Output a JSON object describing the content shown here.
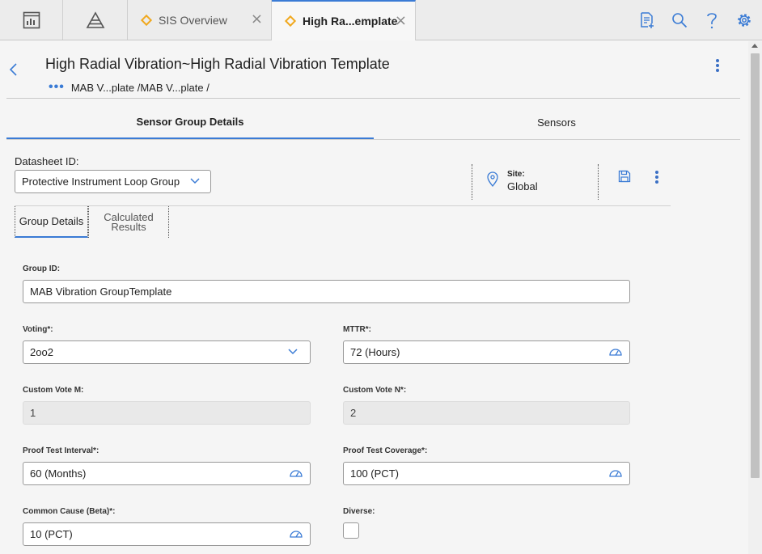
{
  "tabs": {
    "home_icon": "dashboard-icon",
    "hierarchy_icon": "pyramid-icon",
    "items": [
      {
        "label": "SIS Overview",
        "icon": "diamond-icon"
      },
      {
        "label": "High Ra...emplate",
        "icon": "diamond-icon"
      }
    ]
  },
  "toolbar": {
    "icons": [
      "new-document-icon",
      "search-icon",
      "help-icon",
      "settings-icon"
    ]
  },
  "header": {
    "title": "High Radial Vibration~High Radial Vibration Template",
    "breadcrumb": "MAB V...plate /MAB V...plate /"
  },
  "main_tabs": [
    "Sensor Group Details",
    "Sensors"
  ],
  "datasheet": {
    "label": "Datasheet ID:",
    "value": "Protective Instrument Loop Group",
    "site_label": "Site:",
    "site_value": "Global"
  },
  "sub_tabs": [
    "Group Details",
    "Calculated\nResults"
  ],
  "form": {
    "group_id": {
      "label": "Group ID:",
      "value": "MAB Vibration GroupTemplate"
    },
    "voting": {
      "label": "Voting*:",
      "value": "2oo2"
    },
    "mttr": {
      "label": "MTTR*:",
      "value": "72 (Hours)"
    },
    "custom_vote_m": {
      "label": "Custom Vote M:",
      "value": "1"
    },
    "custom_vote_n": {
      "label": "Custom Vote N*:",
      "value": "2"
    },
    "proof_test_interval": {
      "label": "Proof Test Interval*:",
      "value": "60 (Months)"
    },
    "proof_test_coverage": {
      "label": "Proof Test Coverage*:",
      "value": "100 (PCT)"
    },
    "common_cause": {
      "label": "Common Cause (Beta)*:",
      "value": "10 (PCT)"
    },
    "diverse": {
      "label": "Diverse:",
      "checked": false
    }
  },
  "colors": {
    "accent": "#3a7bd5",
    "tab_diamond": "#f0a81e"
  }
}
